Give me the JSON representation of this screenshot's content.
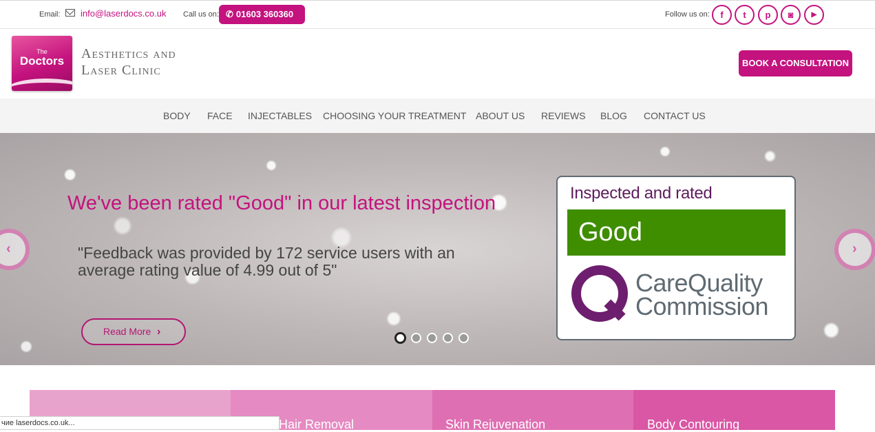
{
  "topbar": {
    "email_label": "Email:",
    "email": "info@laserdocs.co.uk",
    "call_label": "Call us on:",
    "phone": "01603 360360",
    "follow_label": "Follow us on:",
    "social": [
      {
        "name": "facebook-icon",
        "glyph": "f"
      },
      {
        "name": "twitter-icon",
        "glyph": "t"
      },
      {
        "name": "pinterest-icon",
        "glyph": "p"
      },
      {
        "name": "instagram-icon",
        "glyph": "◙"
      },
      {
        "name": "youtube-icon",
        "glyph": "▶"
      }
    ]
  },
  "header": {
    "logo_the": "The",
    "logo_doctors": "Doctors",
    "clinic_line1": "Aesthetics and",
    "clinic_line2": "Laser Clinic",
    "book_label": "BOOK A CONSULTATION"
  },
  "nav": {
    "items": [
      "BODY",
      "FACE",
      "INJECTABLES",
      "CHOOSING YOUR TREATMENT",
      "ABOUT US",
      "REVIEWS",
      "BLOG",
      "CONTACT US"
    ]
  },
  "hero": {
    "title": "We've been rated \"Good\" in our latest inspection",
    "quote": "\"Feedback was provided by 172 service users with an average rating value of 4.99 out of 5\"",
    "read_more": "Read More",
    "slide_count": 5,
    "active_slide": 1
  },
  "cqc": {
    "inspected": "Inspected and rated",
    "rating": "Good",
    "name_line1": "CareQuality",
    "name_line2": "Commission"
  },
  "tiles": [
    "",
    "Hair Removal",
    "Skin Rejuvenation",
    "Body Contouring"
  ],
  "status": "чие laserdocs.co.uk...",
  "colors": {
    "brand": "#c4127e",
    "cqc_green": "#3e8e00",
    "cqc_purple": "#6e1e6e"
  }
}
